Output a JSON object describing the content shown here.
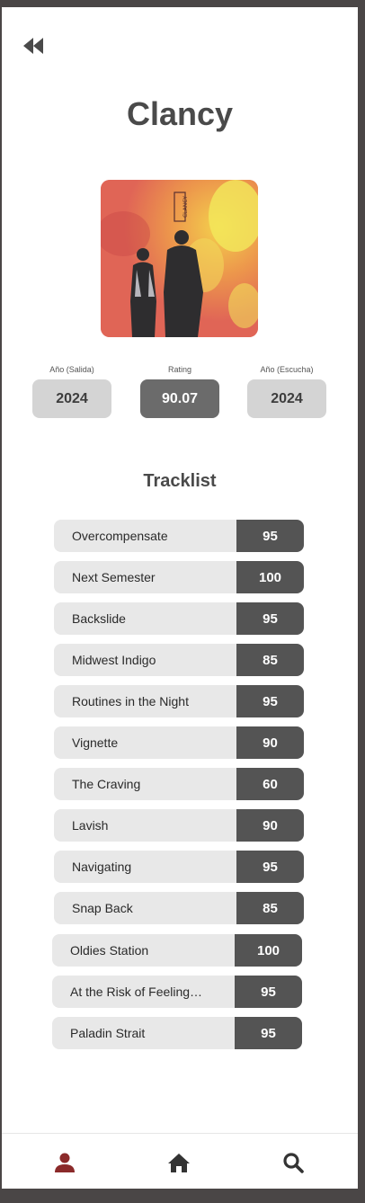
{
  "album": {
    "title": "Clancy",
    "cover_text": "CLANCY"
  },
  "stats": [
    {
      "label": "Año (Salida)",
      "value": "2024"
    },
    {
      "label": "Rating",
      "value": "90.07"
    },
    {
      "label": "Año (Escucha)",
      "value": "2024"
    }
  ],
  "tracklist_title": "Tracklist",
  "tracks": [
    {
      "name": "Overcompensate",
      "score": "95"
    },
    {
      "name": "Next Semester",
      "score": "100"
    },
    {
      "name": "Backslide",
      "score": "95"
    },
    {
      "name": "Midwest Indigo",
      "score": "85"
    },
    {
      "name": "Routines in the Night",
      "score": "95"
    },
    {
      "name": "Vignette",
      "score": "90"
    },
    {
      "name": "The Craving",
      "score": "60"
    },
    {
      "name": "Lavish",
      "score": "90"
    },
    {
      "name": "Navigating",
      "score": "95"
    },
    {
      "name": "Snap Back",
      "score": "85"
    },
    {
      "name": "Oldies Station",
      "score": "100"
    },
    {
      "name": "At the Risk of Feeling…",
      "score": "95"
    },
    {
      "name": "Paladin Strait",
      "score": "95"
    }
  ],
  "icons": {
    "back": "rewind-icon",
    "profile": "user-icon",
    "home": "home-icon",
    "search": "search-icon"
  },
  "colors": {
    "accent_profile": "#8b2a2a",
    "score_bg": "#545454",
    "track_bg": "#e8e8e8"
  }
}
